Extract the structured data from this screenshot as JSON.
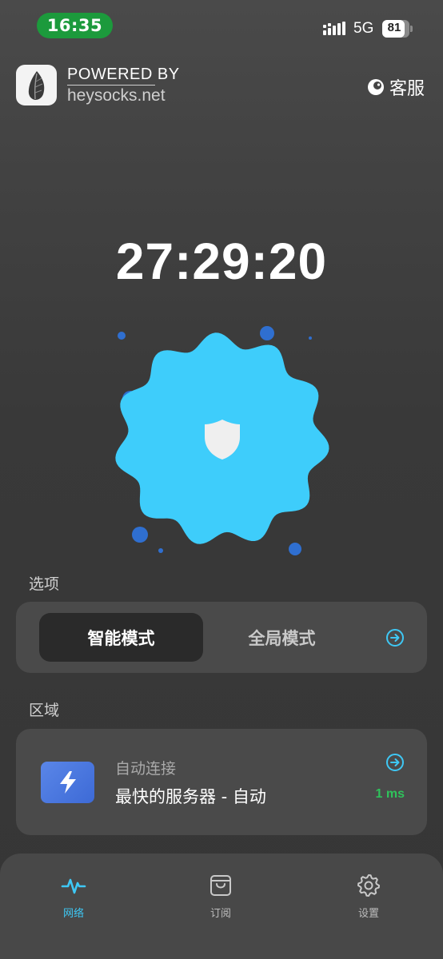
{
  "status_bar": {
    "time": "16:35",
    "network": "5G",
    "battery_percent": "81",
    "battery_level": 0.81
  },
  "header": {
    "powered_by": "POWERED BY",
    "domain": "heysocks.net",
    "support_label": "客服",
    "logo_icon": "feather-logo-icon",
    "support_icon": "chat-bubble-icon"
  },
  "timer": "27:29:20",
  "connect_button": {
    "icon": "shield-icon",
    "color": "#3ecdfb"
  },
  "options": {
    "section_label": "选项",
    "modes": [
      "智能模式",
      "全局模式"
    ],
    "selected": "智能模式"
  },
  "region": {
    "section_label": "区域",
    "subtitle": "自动连接",
    "name": "最快的服务器 - 自动",
    "latency": "1 ms",
    "icon": "lightning-bolt-icon"
  },
  "tabs": [
    {
      "label": "网络",
      "icon": "pulse-icon",
      "active": true
    },
    {
      "label": "订阅",
      "icon": "shopping-bag-icon",
      "active": false
    },
    {
      "label": "设置",
      "icon": "gear-icon",
      "active": false
    }
  ],
  "colors": {
    "accent": "#3ec8f5",
    "latency_green": "#2fc25b",
    "status_pill_green": "#1c9a3c",
    "dot_blue": "#2f6fd0"
  }
}
